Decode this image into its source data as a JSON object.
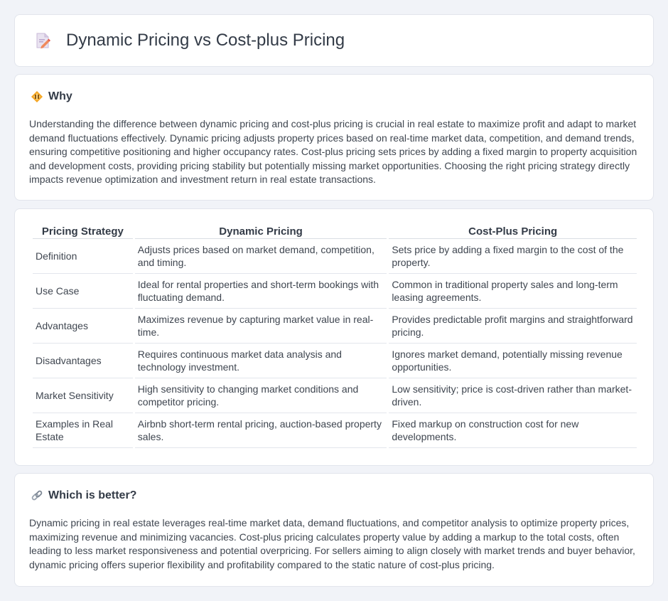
{
  "header": {
    "title": "Dynamic Pricing vs Cost-plus Pricing",
    "icon": "document-edit-icon"
  },
  "why": {
    "title": "Why",
    "icon": "diamond-warning-icon",
    "text": "Understanding the difference between dynamic pricing and cost-plus pricing is crucial in real estate to maximize profit and adapt to market demand fluctuations effectively. Dynamic pricing adjusts property prices based on real-time market data, competition, and demand trends, ensuring competitive positioning and higher occupancy rates. Cost-plus pricing sets prices by adding a fixed margin to property acquisition and development costs, providing pricing stability but potentially missing market opportunities. Choosing the right pricing strategy directly impacts revenue optimization and investment return in real estate transactions."
  },
  "table": {
    "headers": [
      "Pricing Strategy",
      "Dynamic Pricing",
      "Cost-Plus Pricing"
    ],
    "rows": [
      [
        "Definition",
        "Adjusts prices based on market demand, competition, and timing.",
        "Sets price by adding a fixed margin to the cost of the property."
      ],
      [
        "Use Case",
        "Ideal for rental properties and short-term bookings with fluctuating demand.",
        "Common in traditional property sales and long-term leasing agreements."
      ],
      [
        "Advantages",
        "Maximizes revenue by capturing market value in real-time.",
        "Provides predictable profit margins and straightforward pricing."
      ],
      [
        "Disadvantages",
        "Requires continuous market data analysis and technology investment.",
        "Ignores market demand, potentially missing revenue opportunities."
      ],
      [
        "Market Sensitivity",
        "High sensitivity to changing market conditions and competitor pricing.",
        "Low sensitivity; price is cost-driven rather than market-driven."
      ],
      [
        "Examples in Real Estate",
        "Airbnb short-term rental pricing, auction-based property sales.",
        "Fixed markup on construction cost for new developments."
      ]
    ]
  },
  "better": {
    "title": "Which is better?",
    "icon": "link-icon",
    "text": "Dynamic pricing in real estate leverages real-time market data, demand fluctuations, and competitor analysis to optimize property prices, maximizing revenue and minimizing vacancies. Cost-plus pricing calculates property value by adding a markup to the total costs, often leading to less market responsiveness and potential overpricing. For sellers aiming to align closely with market trends and buyer behavior, dynamic pricing offers superior flexibility and profitability compared to the static nature of cost-plus pricing."
  }
}
